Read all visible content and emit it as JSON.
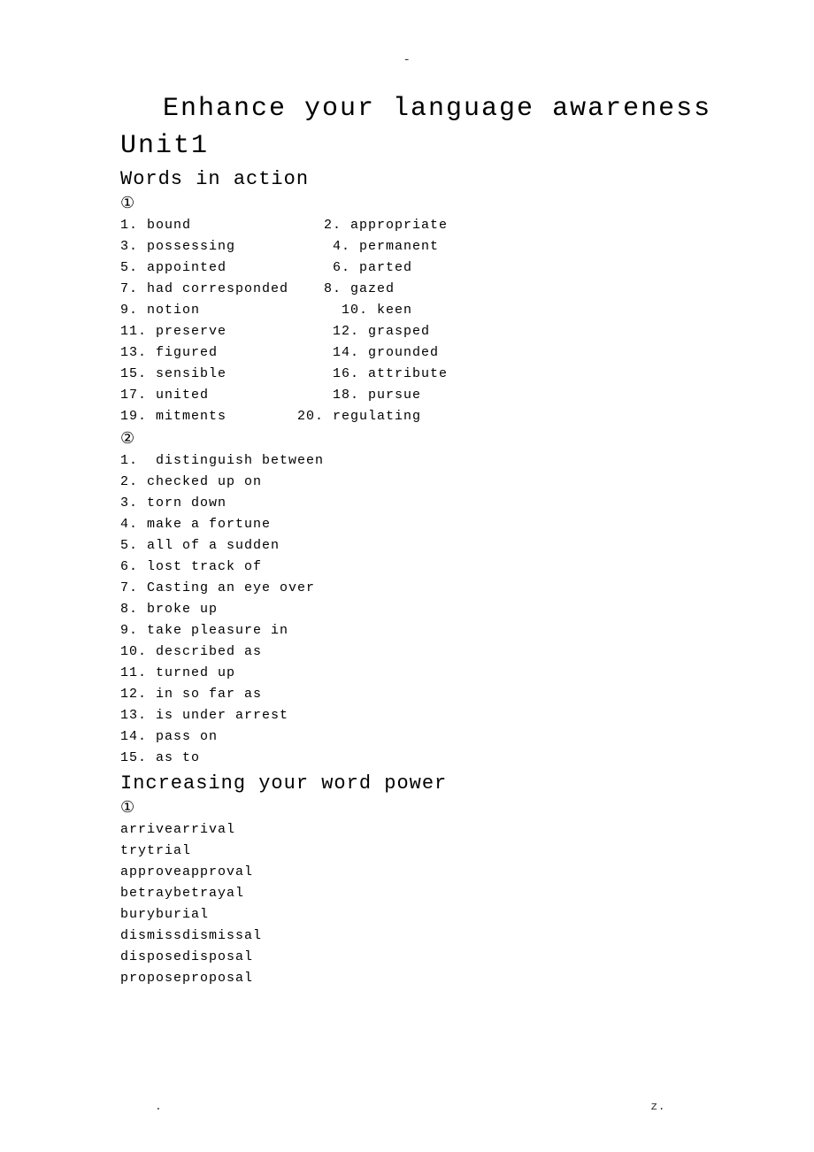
{
  "top_marker": "-",
  "main_title": "Enhance your language awareness",
  "unit_title": "Unit1",
  "section1_title": "Words in action",
  "circled_1": "①",
  "words1": [
    "1. bound               2. appropriate",
    "3. possessing           4. permanent",
    "5. appointed            6. parted",
    "7. had corresponded    8. gazed",
    "9. notion                10. keen",
    "11. preserve            12. grasped",
    "13. figured             14. grounded",
    "15. sensible            16. attribute",
    "17. united              18. pursue",
    "19. mitments        20. regulating"
  ],
  "circled_2": "②",
  "words2": [
    "1.  distinguish between",
    "2. checked up on",
    "3. torn down",
    "4. make a fortune",
    "5. all of a sudden",
    "6. lost track of",
    "7. Casting an eye over",
    "8. broke up",
    "9. take pleasure in",
    "10. described as",
    "11. turned up",
    "12. in so far as",
    "13. is under arrest",
    "14. pass on",
    "15. as to"
  ],
  "section2_title": "Increasing your word power",
  "circled_3": "①",
  "words3": [
    "arrivearrival",
    "trytrial",
    "approveapproval",
    "betraybetrayal",
    "buryburial",
    "dismissdismissal",
    "disposedisposal",
    "proposeproposal"
  ],
  "footer_left": ".",
  "footer_right": "z."
}
